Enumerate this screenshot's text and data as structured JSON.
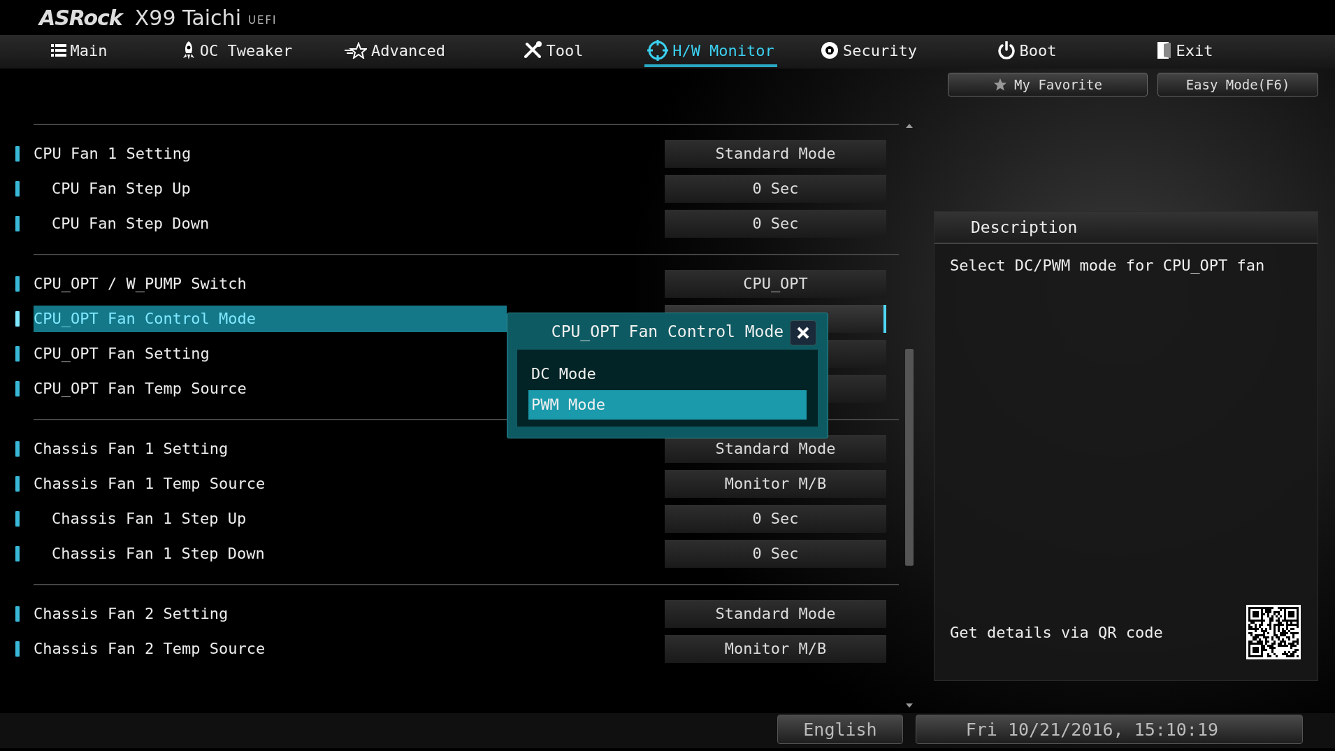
{
  "header": {
    "brand": "ASRock",
    "model": "X99 Taichi",
    "firmware": "UEFI"
  },
  "tabs": [
    {
      "label": "Main",
      "selected": false
    },
    {
      "label": "OC Tweaker",
      "selected": false
    },
    {
      "label": "Advanced",
      "selected": false
    },
    {
      "label": "Tool",
      "selected": false
    },
    {
      "label": "H/W Monitor",
      "selected": true
    },
    {
      "label": "Security",
      "selected": false
    },
    {
      "label": "Boot",
      "selected": false
    },
    {
      "label": "Exit",
      "selected": false
    }
  ],
  "quick_buttons": [
    "My Favorite",
    "Easy Mode(F6)"
  ],
  "settings": {
    "groups": [
      {
        "items": [
          {
            "label": "CPU Fan 1 Setting",
            "value": "Standard Mode",
            "selected": false,
            "children": [
              {
                "label": "CPU Fan Step Up",
                "value": "0 Sec",
                "selected": false
              },
              {
                "label": "CPU Fan Step Down",
                "value": "0 Sec",
                "selected": false
              }
            ]
          }
        ]
      },
      {
        "items": [
          {
            "label": "CPU_OPT / W_PUMP Switch",
            "value": "CPU_OPT",
            "selected": false
          },
          {
            "label": "CPU_OPT Fan Control Mode",
            "selected": true
          },
          {
            "label": "CPU_OPT Fan Setting",
            "selected": false
          },
          {
            "label": "CPU_OPT Fan Temp Source",
            "selected": false
          }
        ]
      },
      {
        "items": [
          {
            "label": "Chassis Fan 1 Setting",
            "value": "Standard Mode",
            "selected": false
          },
          {
            "label": "Chassis Fan 1 Temp Source",
            "value": "Monitor M/B",
            "selected": false,
            "children": [
              {
                "label": "Chassis Fan 1 Step Up",
                "value": "0 Sec",
                "selected": false
              },
              {
                "label": "Chassis Fan 1 Step Down",
                "value": "0 Sec",
                "selected": false
              }
            ]
          }
        ]
      },
      {
        "items": [
          {
            "label": "Chassis Fan 2 Setting",
            "value": "Standard Mode",
            "selected": false
          },
          {
            "label": "Chassis Fan 2 Temp Source",
            "value": "Monitor M/B",
            "selected": false
          }
        ]
      }
    ]
  },
  "description": {
    "title": "Description",
    "text": "Select DC/PWM mode for CPU_OPT fan",
    "qr_hint": "Get details via QR code"
  },
  "dialog": {
    "title": "CPU_OPT Fan Control Mode",
    "options": [
      {
        "label": "DC Mode",
        "selected": false
      },
      {
        "label": "PWM Mode",
        "selected": true
      }
    ]
  },
  "status_bar": {
    "language": "English",
    "datetime": "Fri 10/21/2016, 15:10:19"
  }
}
